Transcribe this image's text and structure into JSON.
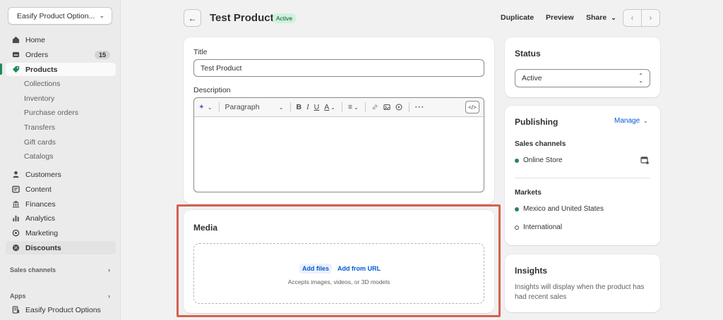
{
  "sidebar": {
    "store_name": "Easify Product Option...",
    "items": [
      {
        "label": "Home",
        "icon": "home-icon"
      },
      {
        "label": "Orders",
        "icon": "orders-icon",
        "badge": "15"
      },
      {
        "label": "Products",
        "icon": "tag-icon"
      }
    ],
    "product_subitems": [
      "Collections",
      "Inventory",
      "Purchase orders",
      "Transfers",
      "Gift cards",
      "Catalogs"
    ],
    "items2": [
      {
        "label": "Customers",
        "icon": "person-icon"
      },
      {
        "label": "Content",
        "icon": "content-icon"
      },
      {
        "label": "Finances",
        "icon": "bank-icon"
      },
      {
        "label": "Analytics",
        "icon": "bar-chart-icon"
      },
      {
        "label": "Marketing",
        "icon": "target-icon"
      },
      {
        "label": "Discounts",
        "icon": "discount-icon"
      }
    ],
    "sales_channels_label": "Sales channels",
    "apps_label": "Apps",
    "app_item": "Easify Product Options"
  },
  "header": {
    "title": "Test Product",
    "status": "Active",
    "actions": {
      "duplicate": "Duplicate",
      "preview": "Preview",
      "share": "Share"
    }
  },
  "product_form": {
    "title_label": "Title",
    "title_value": "Test Product",
    "description_label": "Description",
    "paragraph_option": "Paragraph"
  },
  "media": {
    "title": "Media",
    "add_files": "Add files",
    "add_from_url": "Add from URL",
    "accepts": "Accepts images, videos, or 3D models"
  },
  "status_card": {
    "title": "Status",
    "value": "Active"
  },
  "publishing": {
    "title": "Publishing",
    "manage": "Manage",
    "sales_channels_label": "Sales channels",
    "channel": "Online Store",
    "markets_label": "Markets",
    "markets": [
      "Mexico and United States",
      "International"
    ]
  },
  "insights": {
    "title": "Insights",
    "text": "Insights will display when the product has had recent sales"
  },
  "colors": {
    "accent_green": "#1f8a5b",
    "link_blue": "#005bd3",
    "highlight_red": "#d6604f"
  }
}
